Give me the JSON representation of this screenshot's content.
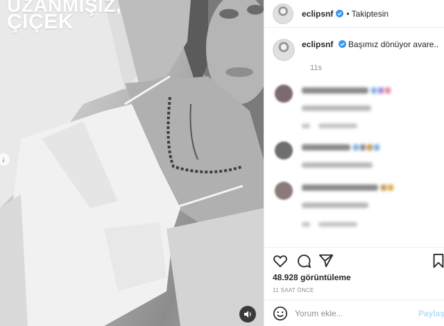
{
  "media": {
    "overlay_line1": "UZANMIŞIZ,",
    "overlay_line2": "ÇIÇEK"
  },
  "header": {
    "username": "eclipsnf",
    "follow_status": "• Takiptesin"
  },
  "caption": {
    "username": "eclipsnf",
    "text": "Başımız dönüyor avare...",
    "time": "11s"
  },
  "comments": [
    {
      "blurred": true
    },
    {
      "blurred": true
    },
    {
      "blurred": true
    }
  ],
  "stats": {
    "views": "48.928 görüntüleme",
    "posted": "11 SAAT ÖNCE"
  },
  "add_comment": {
    "placeholder": "Yorum ekle...",
    "share_label": "Paylaş"
  },
  "icons": {
    "like": "heart-icon",
    "comment": "comment-bubble-icon",
    "share": "paper-plane-icon",
    "save": "bookmark-icon",
    "emoji": "emoji-icon",
    "mute": "speaker-icon"
  },
  "colors": {
    "verified": "#3897f0",
    "share_link": "#b2dffc",
    "secondary_text": "#8e8e8e"
  }
}
